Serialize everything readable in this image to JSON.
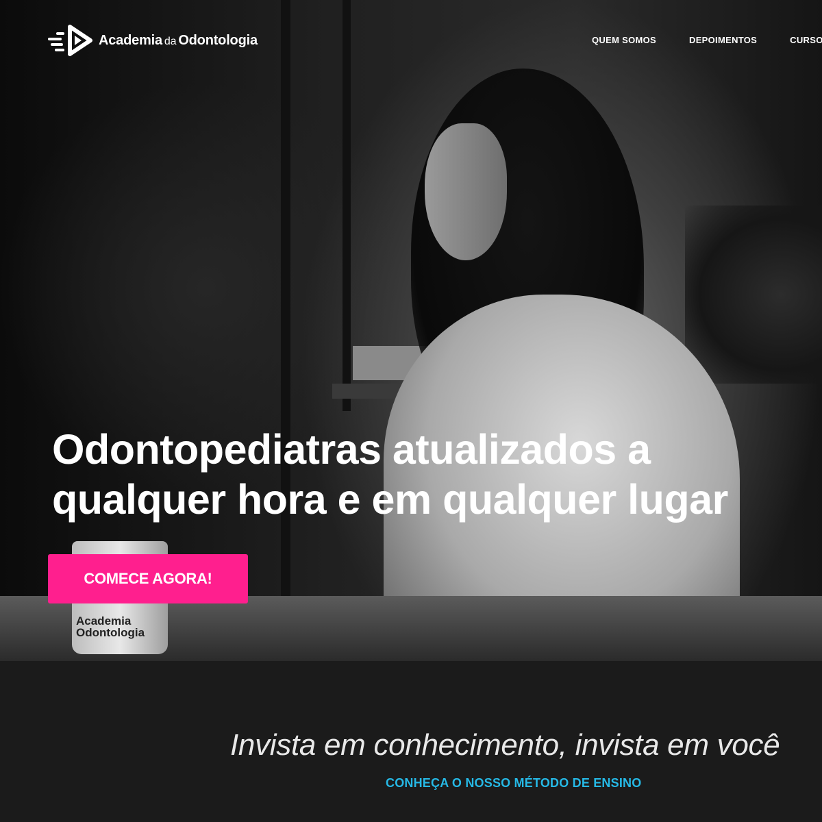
{
  "header": {
    "logo_name": "Academia",
    "logo_connector": "da",
    "logo_name_2": "Odontologia",
    "nav": [
      "QUEM SOMOS",
      "DEPOIMENTOS",
      "CURSOS"
    ]
  },
  "hero": {
    "headline_line1": "Odontopediatras atualizados a",
    "headline_line2": "qualquer hora e em qualquer lugar",
    "cta_label": "COMECE AGORA!",
    "mug_text_1": "Academia",
    "mug_text_2": "Odontologia"
  },
  "lower": {
    "tagline": "Invista em conhecimento, invista em você",
    "method_link": "CONHEÇA O NOSSO MÉTODO DE ENSINO"
  },
  "colors": {
    "accent_pink": "#ff1f8e",
    "link_blue": "#26b9e6",
    "lower_bg": "#1b1b1b"
  }
}
